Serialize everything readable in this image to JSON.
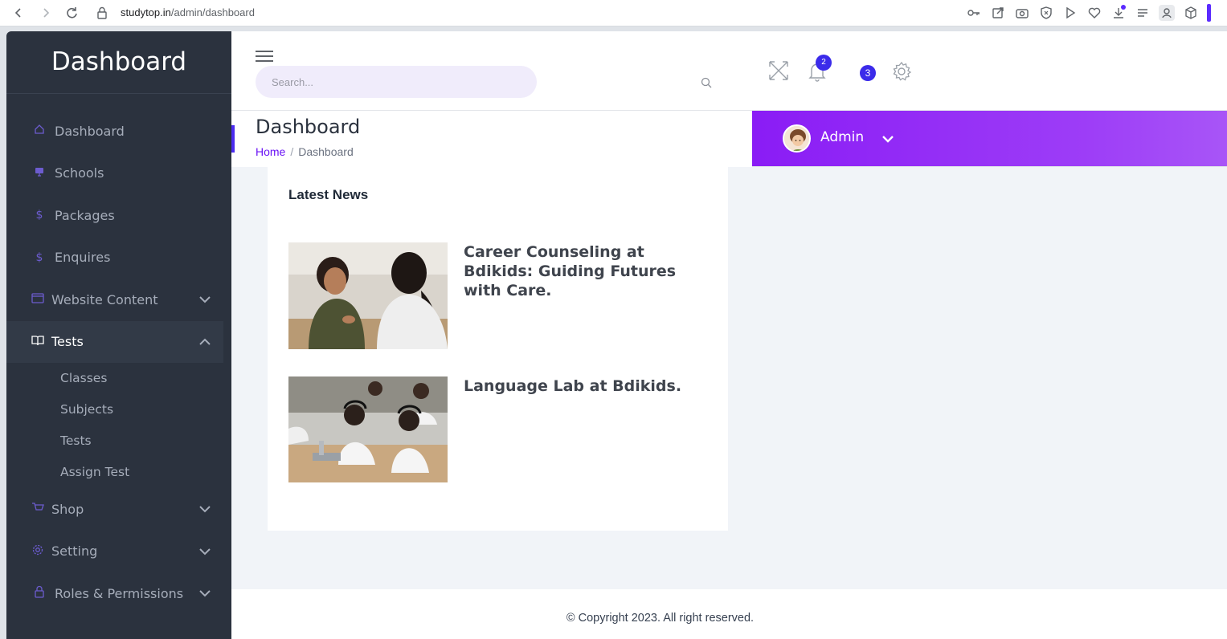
{
  "browser": {
    "url_host": "studytop.in",
    "url_path": "/admin/dashboard"
  },
  "sidebar": {
    "title": "Dashboard",
    "items": [
      {
        "label": "Dashboard",
        "icon": "home-icon",
        "expandable": false
      },
      {
        "label": "Schools",
        "icon": "monitor-icon",
        "expandable": false
      },
      {
        "label": "Packages",
        "icon": "dollar-icon",
        "expandable": false
      },
      {
        "label": "Enquires",
        "icon": "dollar-icon",
        "expandable": false
      },
      {
        "label": "Website Content",
        "icon": "calendar-icon",
        "expandable": true,
        "expanded": false
      },
      {
        "label": "Tests",
        "icon": "book-icon",
        "expandable": true,
        "expanded": true,
        "active": true
      },
      {
        "label": "Shop",
        "icon": "cart-icon",
        "expandable": true,
        "expanded": false
      },
      {
        "label": "Setting",
        "icon": "gear-icon",
        "expandable": true,
        "expanded": false
      },
      {
        "label": "Roles & Permissions",
        "icon": "lock-icon",
        "expandable": true,
        "expanded": false
      }
    ],
    "tests_submenu": [
      "Classes",
      "Subjects",
      "Tests",
      "Assign Test"
    ]
  },
  "header": {
    "search_placeholder": "Search...",
    "notification_count": "2",
    "message_count": "3"
  },
  "page": {
    "title": "Dashboard",
    "breadcrumb_home": "Home",
    "breadcrumb_sep": "/",
    "breadcrumb_current": "Dashboard"
  },
  "user": {
    "name": "Admin"
  },
  "news": {
    "title": "Latest News",
    "items": [
      {
        "title": "Career Counseling at Bdikids: Guiding Futures with Care."
      },
      {
        "title": "Language Lab at Bdikids."
      }
    ]
  },
  "footer": {
    "copyright": "© Copyright 2023. All right reserved."
  },
  "colors": {
    "sidebar_bg": "#2b323e",
    "accent_purple": "#8a1cf5",
    "badge_blue": "#3b2bea",
    "link_purple": "#6a12f5"
  }
}
